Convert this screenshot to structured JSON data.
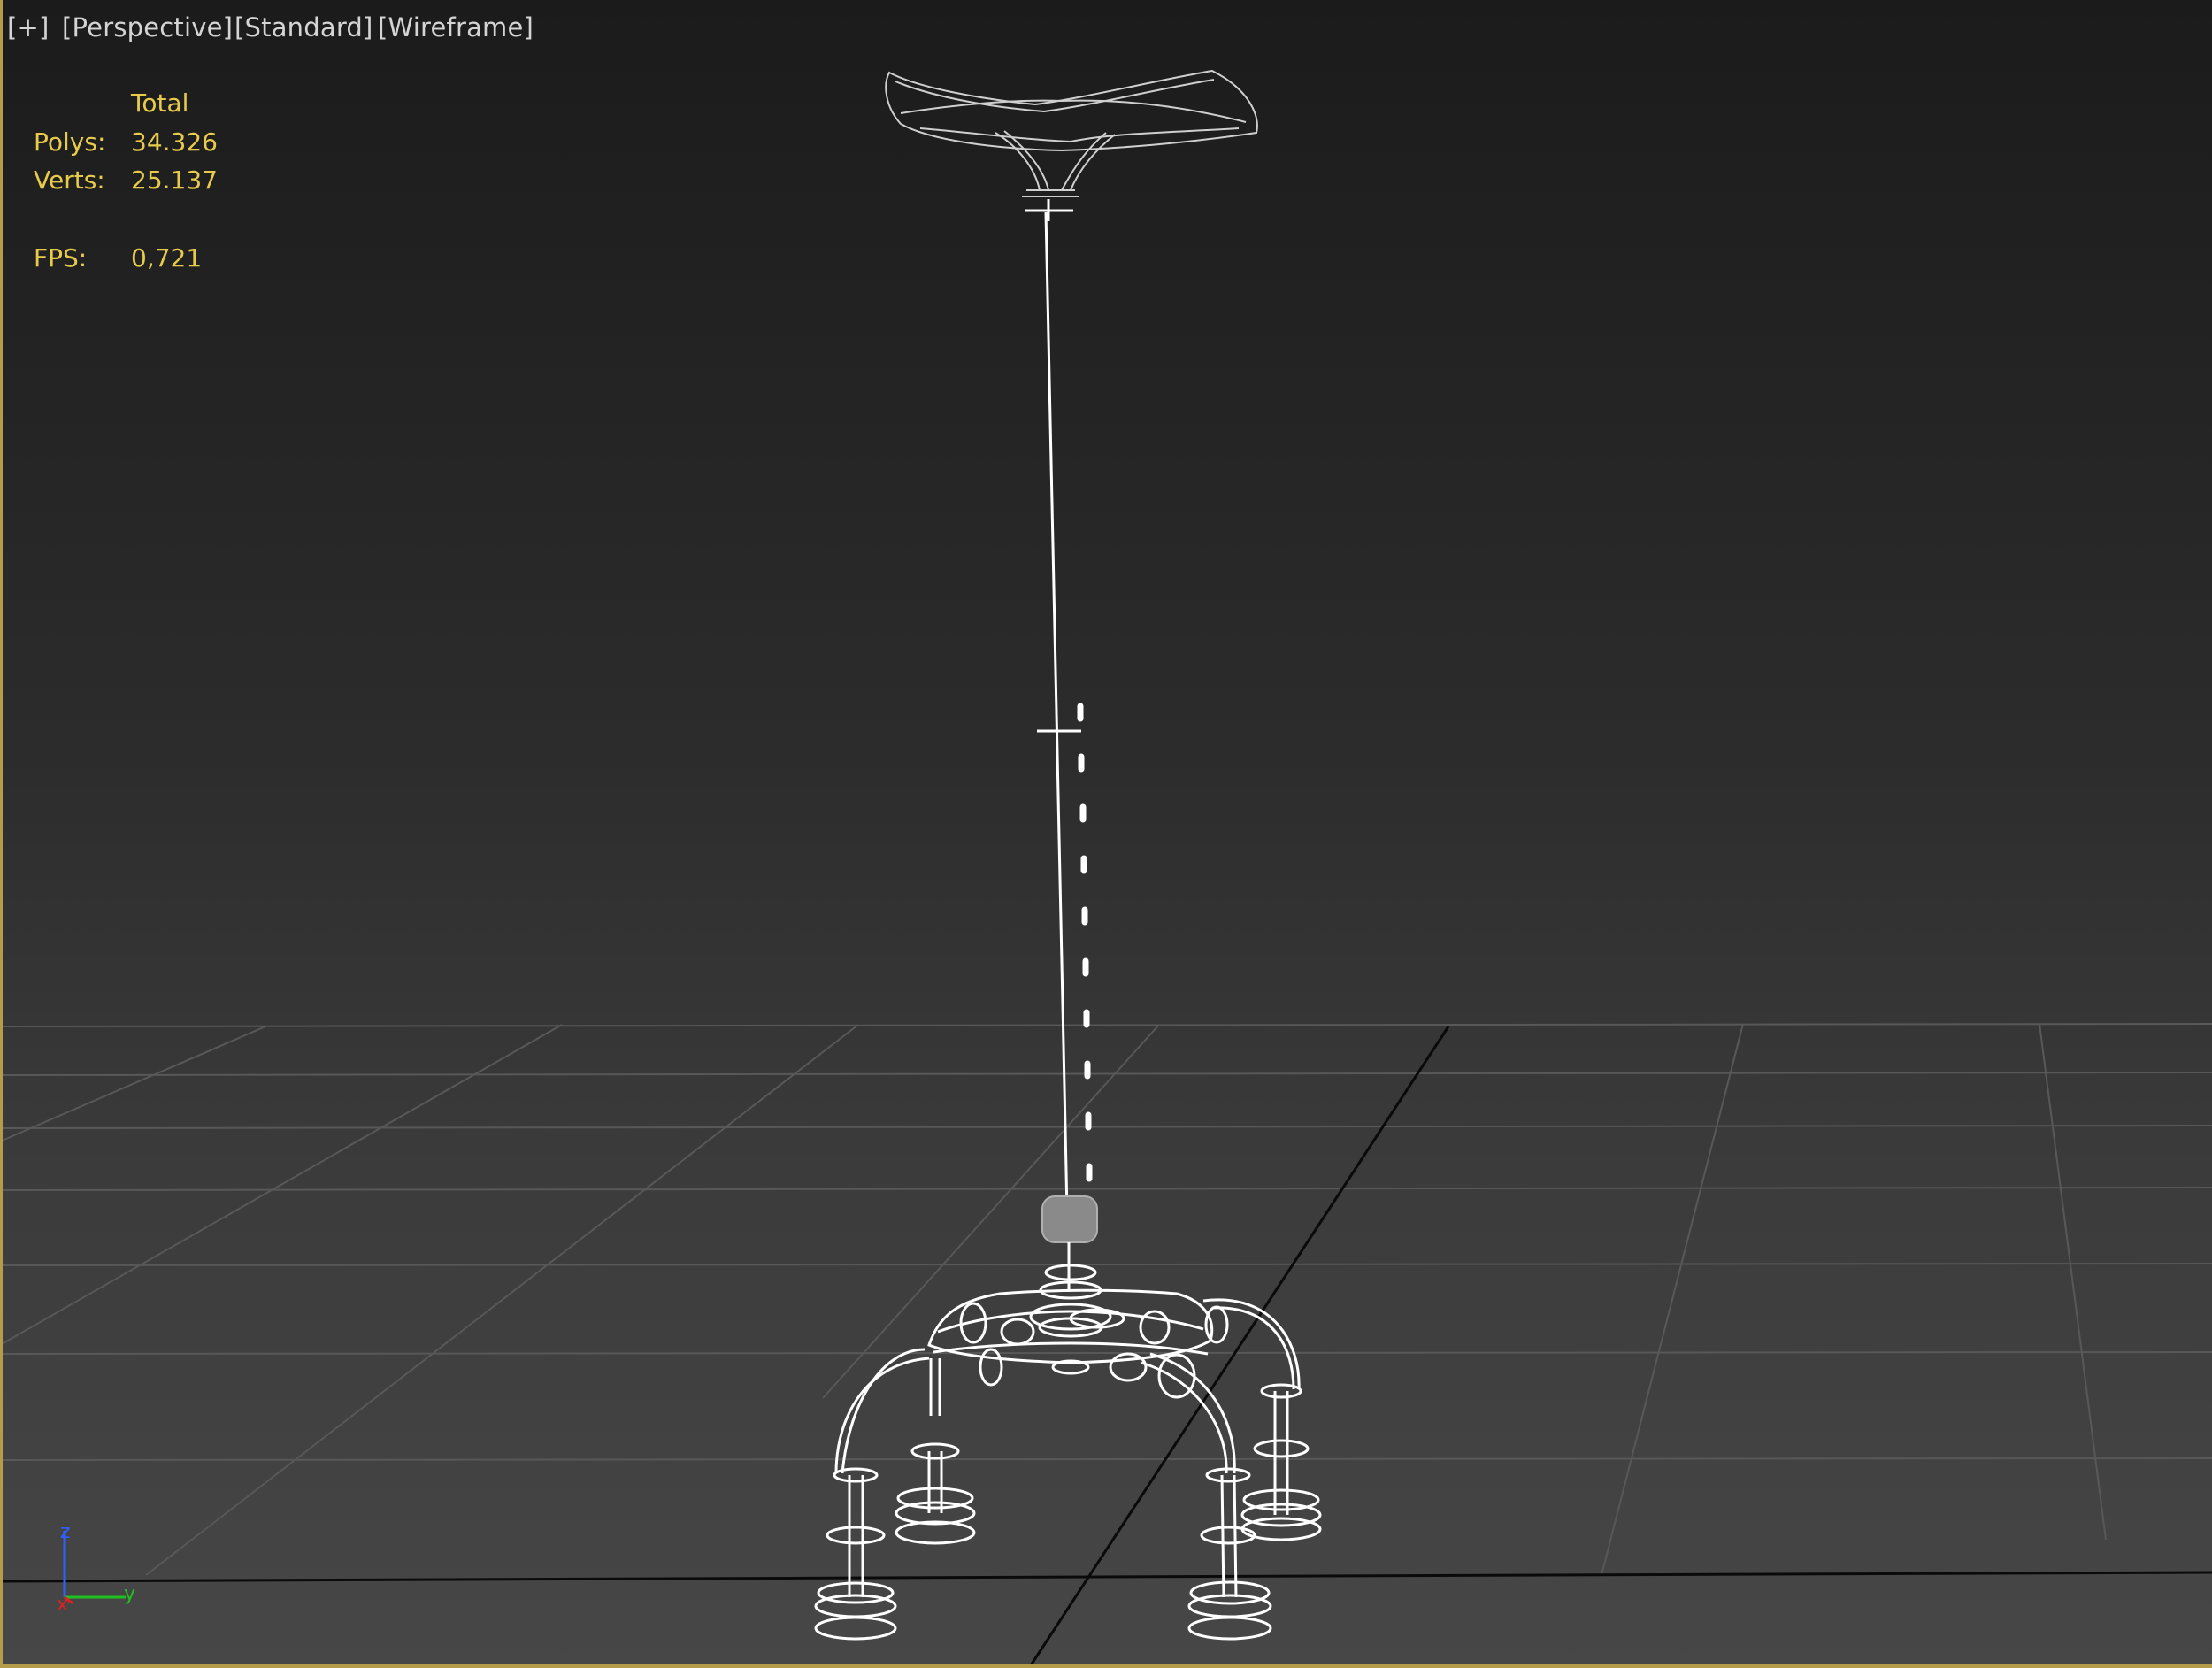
{
  "viewport": {
    "labels": {
      "plus": "[+]",
      "view": "[Perspective]",
      "shading": "[Standard]",
      "display": "[Wireframe]"
    },
    "stats": {
      "header": "Total",
      "polys_label": "Polys:",
      "polys_value": "34.326",
      "verts_label": "Verts:",
      "verts_value": "25.137",
      "fps_label": "FPS:",
      "fps_value": "0,721"
    },
    "axis": {
      "z": "z",
      "y": "y",
      "x": "x"
    },
    "colors": {
      "border": "#b49c4a",
      "stats_text": "#e8cb4a",
      "wire": "#ffffff",
      "grid": "#5a5a5a",
      "axis_x": "#e02020",
      "axis_y": "#20c020",
      "axis_z": "#3060ff"
    }
  }
}
